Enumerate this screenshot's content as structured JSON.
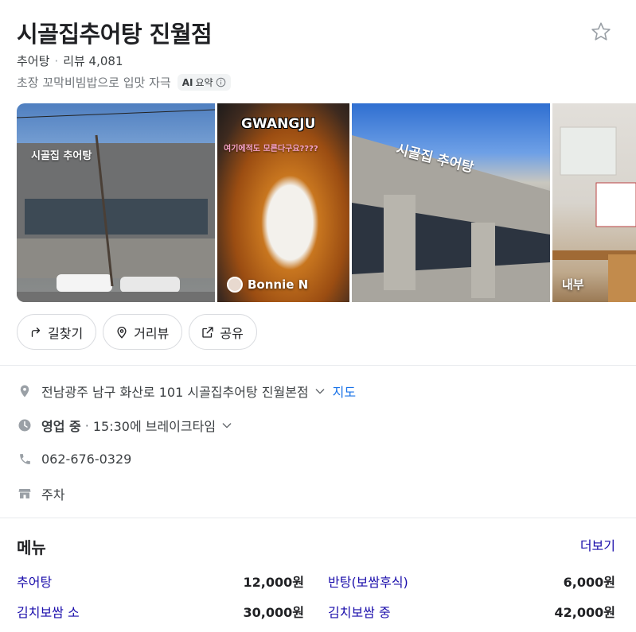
{
  "place": {
    "name": "시골집추어탕 진월점",
    "category": "추어탕",
    "reviews": "리뷰 4,081",
    "summary": "초장 꼬막비빔밥으로 입맛 자극",
    "ai_badge": "AI",
    "ai_label": "요약"
  },
  "photos": [
    {
      "label": "",
      "sign": "시골집 추어탕"
    },
    {
      "label": "Bonnie N",
      "top_text": "GWANGJU",
      "sub_text": "여기에적도 모른다구요????"
    },
    {
      "label": "",
      "sign": "시골집 추어탕"
    },
    {
      "label": "내부"
    }
  ],
  "actions": {
    "directions": "길찾기",
    "street_view": "거리뷰",
    "share": "공유"
  },
  "info": {
    "address": "전남광주 남구 화산로 101 시골집추어탕 진월본점",
    "map_link": "지도",
    "status": "영업 중",
    "hours_detail": "15:30에 브레이크타임",
    "phone": "062-676-0329",
    "parking": "주차"
  },
  "menu": {
    "title": "메뉴",
    "more": "더보기",
    "items": [
      {
        "name": "추어탕",
        "price": "12,000원"
      },
      {
        "name": "반탕(보쌈후식)",
        "price": "6,000원"
      },
      {
        "name": "김치보쌈 소",
        "price": "30,000원"
      },
      {
        "name": "김치보쌈 중",
        "price": "42,000원"
      }
    ]
  },
  "colors": {
    "link": "#1a0dab",
    "map_link": "#1a73e8",
    "text": "#202124",
    "muted": "#70757a"
  }
}
